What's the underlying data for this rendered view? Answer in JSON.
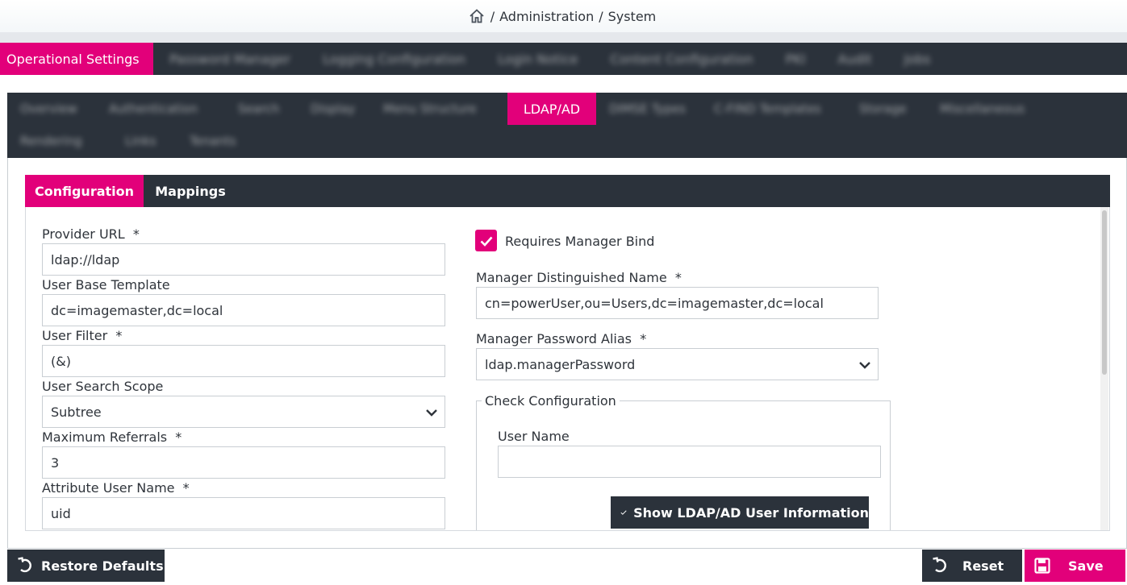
{
  "breadcrumb": {
    "home_icon": "home-icon",
    "separator": "/",
    "section": "Administration",
    "page": "System"
  },
  "main_tabs": {
    "active": "Operational Settings",
    "blurred": [
      "Password Manager",
      "Logging Configuration",
      "Login Notice",
      "Content Configuration",
      "PKI",
      "Audit",
      "Jobs"
    ]
  },
  "sub_tabs": {
    "row1": [
      "Overview",
      "Authentication",
      "Search",
      "Display",
      "Menu Structure",
      "LDAP/AD",
      "DIMSE Types",
      "C-FIND Templates",
      "Storage",
      "Miscellaneous"
    ],
    "row2": [
      "Rendering",
      "Links",
      "Tenants"
    ],
    "active": "LDAP/AD"
  },
  "inner_tabs": {
    "configuration": "Configuration",
    "mappings": "Mappings"
  },
  "form": {
    "provider_url": {
      "label": "Provider URL",
      "required": "*",
      "value": "ldap://ldap"
    },
    "user_base_template": {
      "label": "User Base Template",
      "value": "dc=imagemaster,dc=local"
    },
    "user_filter": {
      "label": "User Filter",
      "required": "*",
      "value": "(&)"
    },
    "user_search_scope": {
      "label": "User Search Scope",
      "value": "Subtree"
    },
    "maximum_referrals": {
      "label": "Maximum Referrals",
      "required": "*",
      "value": "3"
    },
    "attribute_user_name": {
      "label": "Attribute User Name",
      "required": "*",
      "value": "uid"
    },
    "requires_manager_bind": {
      "label": "Requires Manager Bind",
      "checked": true
    },
    "manager_dn": {
      "label": "Manager Distinguished Name",
      "required": "*",
      "value": "cn=powerUser,ou=Users,dc=imagemaster,dc=local"
    },
    "manager_password_alias": {
      "label": "Manager Password Alias",
      "required": "*",
      "value": "ldap.managerPassword"
    },
    "check_configuration": {
      "legend": "Check Configuration",
      "user_name_label": "User Name",
      "user_name_value": "",
      "show_button": "Show LDAP/AD User Information"
    }
  },
  "footer": {
    "restore_defaults": "Restore Defaults",
    "reset": "Reset",
    "save": "Save"
  },
  "colors": {
    "accent": "#e2007a",
    "dark": "#2b323b"
  }
}
